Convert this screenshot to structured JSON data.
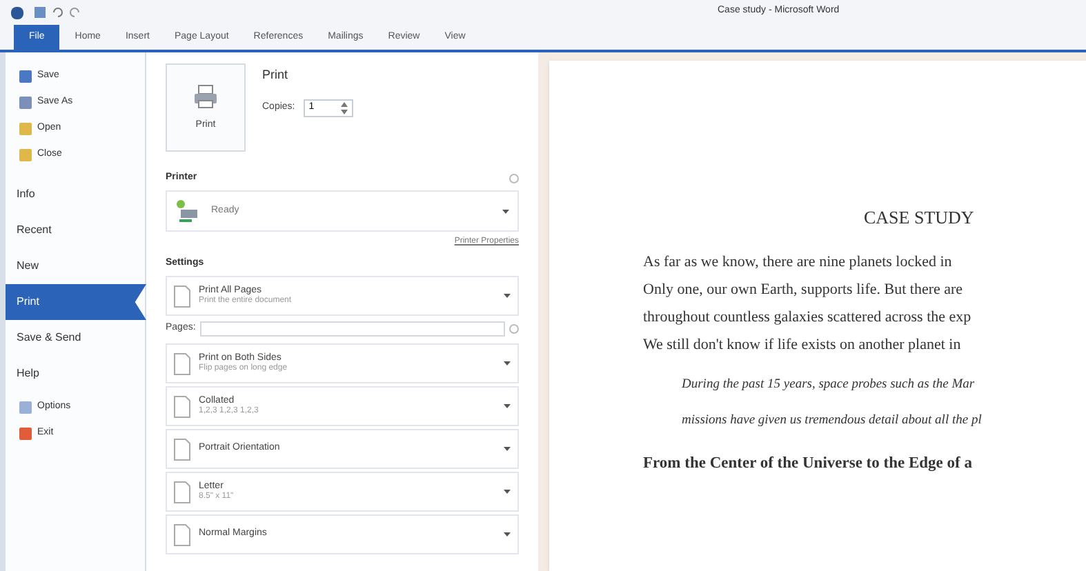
{
  "window": {
    "title": "Case study - Microsoft Word"
  },
  "tabs": [
    {
      "label": "File",
      "selected": true
    },
    {
      "label": "Home",
      "selected": false
    },
    {
      "label": "Insert",
      "selected": false
    },
    {
      "label": "Page Layout",
      "selected": false
    },
    {
      "label": "References",
      "selected": false
    },
    {
      "label": "Mailings",
      "selected": false
    },
    {
      "label": "Review",
      "selected": false
    },
    {
      "label": "View",
      "selected": false
    }
  ],
  "sidebar": {
    "items": [
      {
        "label": "Save",
        "kind": "command",
        "selected": false
      },
      {
        "label": "Save As",
        "kind": "command",
        "selected": false
      },
      {
        "label": "Open",
        "kind": "command",
        "selected": false
      },
      {
        "label": "Close",
        "kind": "command",
        "selected": false
      },
      {
        "label": "Info",
        "kind": "page",
        "selected": false
      },
      {
        "label": "Recent",
        "kind": "page",
        "selected": false
      },
      {
        "label": "New",
        "kind": "page",
        "selected": false
      },
      {
        "label": "Print",
        "kind": "page",
        "selected": true
      },
      {
        "label": "Save & Send",
        "kind": "page",
        "selected": false
      },
      {
        "label": "Help",
        "kind": "page",
        "selected": false
      },
      {
        "label": "Options",
        "kind": "command",
        "selected": false
      },
      {
        "label": "Exit",
        "kind": "command",
        "selected": false
      }
    ]
  },
  "print": {
    "button": "Print",
    "heading": "Print",
    "copies_label": "Copies:",
    "copies": "1"
  },
  "printer": {
    "heading": "Printer",
    "status": "Ready",
    "properties_link": "Printer Properties"
  },
  "settings": {
    "heading": "Settings",
    "pages_label": "Pages:",
    "options": [
      {
        "title": "Print All Pages",
        "subtitle": "Print the entire document"
      },
      {
        "title": "Print on Both Sides",
        "subtitle": "Flip pages on long edge"
      },
      {
        "title": "Collated",
        "subtitle": "1,2,3   1,2,3   1,2,3"
      },
      {
        "title": "Portrait Orientation"
      },
      {
        "title": "Letter",
        "subtitle": "8.5\" x 11\""
      },
      {
        "title": "Normal Margins"
      }
    ]
  },
  "preview": {
    "title": "CASE STUDY",
    "paragraph": [
      "As far as we know, there are nine planets locked in",
      "Only one, our own Earth, supports life. But there are",
      "throughout countless galaxies scattered across the exp",
      "We still don't know if life exists on another planet in"
    ],
    "quote": [
      "During the past 15 years, space probes such as the Mar",
      "missions have given us tremendous detail about all the pl"
    ],
    "heading": "From the Center of the Universe to the Edge of a"
  }
}
